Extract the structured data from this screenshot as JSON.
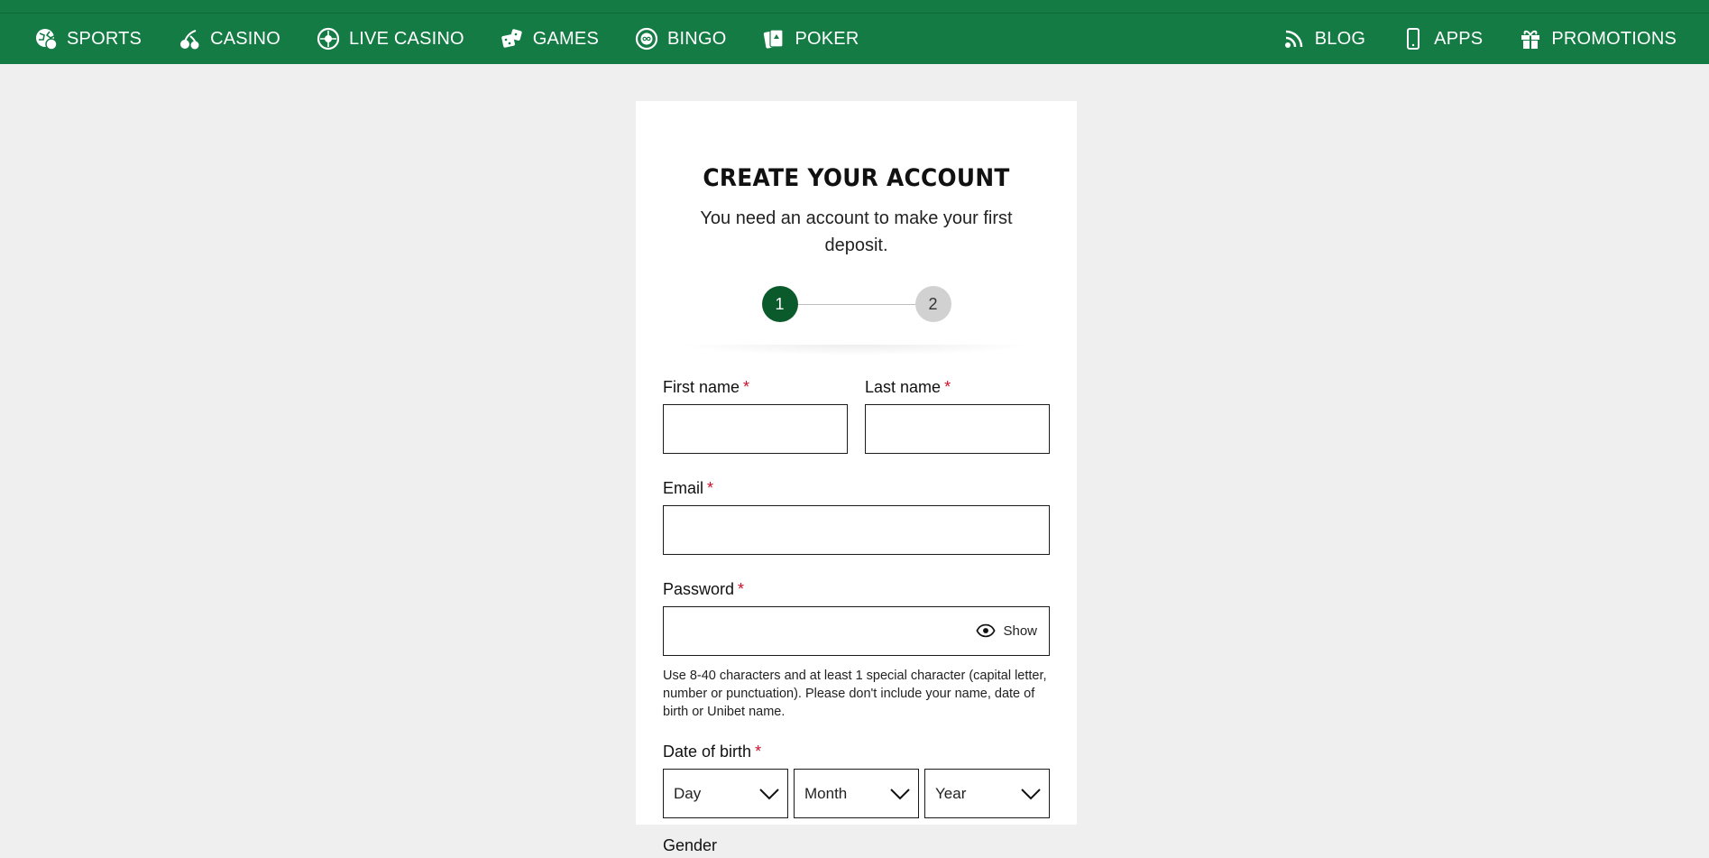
{
  "nav": {
    "left": [
      {
        "label": "SPORTS",
        "icon": "sports-ball-icon"
      },
      {
        "label": "CASINO",
        "icon": "cherries-icon"
      },
      {
        "label": "LIVE CASINO",
        "icon": "roulette-icon"
      },
      {
        "label": "GAMES",
        "icon": "dice-icon"
      },
      {
        "label": "BINGO",
        "icon": "bingo-ball-icon"
      },
      {
        "label": "POKER",
        "icon": "playing-card-icon"
      }
    ],
    "right": [
      {
        "label": "BLOG",
        "icon": "rss-icon"
      },
      {
        "label": "APPS",
        "icon": "mobile-phone-icon"
      },
      {
        "label": "PROMOTIONS",
        "icon": "gift-icon"
      }
    ]
  },
  "signup": {
    "title": "CREATE YOUR ACCOUNT",
    "subtitle": "You need an account to make your first deposit.",
    "steps": [
      "1",
      "2"
    ],
    "first_name_label": "First name",
    "last_name_label": "Last name",
    "email_label": "Email",
    "password_label": "Password",
    "required_mark": "*",
    "show_label": "Show",
    "password_hint": "Use 8-40 characters and at least 1 special character (capital letter, number or punctuation). Please don't include your name, date of birth or Unibet name.",
    "dob_label": "Date of birth",
    "day_placeholder": "Day",
    "month_placeholder": "Month",
    "year_placeholder": "Year",
    "next_label_partial": "Gender"
  },
  "colors": {
    "nav_bg": "#147b45",
    "active_step": "#0b5a2c",
    "inactive_step": "#d1d1d1",
    "required": "#c8102e",
    "page_bg": "#efefef"
  }
}
